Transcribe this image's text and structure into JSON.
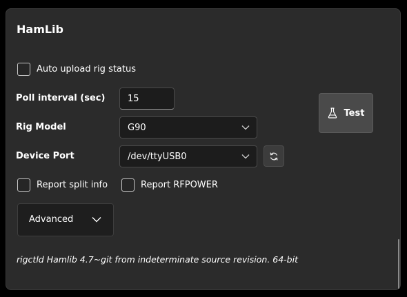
{
  "panel": {
    "title": "HamLib"
  },
  "auto_upload": {
    "label": "Auto upload rig status",
    "checked": false
  },
  "poll_interval": {
    "label": "Poll interval (sec)",
    "value": "15"
  },
  "rig_model": {
    "label": "Rig Model",
    "selected": "G90"
  },
  "device_port": {
    "label": "Device Port",
    "selected": "/dev/ttyUSB0"
  },
  "report_split": {
    "label": "Report split info",
    "checked": false
  },
  "report_rfpower": {
    "label": "Report RFPOWER",
    "checked": false
  },
  "test_button": {
    "label": "Test",
    "icon": "flask-icon"
  },
  "advanced": {
    "label": "Advanced",
    "icon": "chevron-down-icon"
  },
  "refresh_button": {
    "icon": "refresh-icon"
  },
  "version_text": "rigctld Hamlib 4.7~git from indeterminate source revision. 64-bit",
  "colors": {
    "background": "#000000",
    "panel": "#2b2b2b",
    "input": "#1c1c1c",
    "button": "#4a4a4a",
    "text": "#ffffff"
  }
}
